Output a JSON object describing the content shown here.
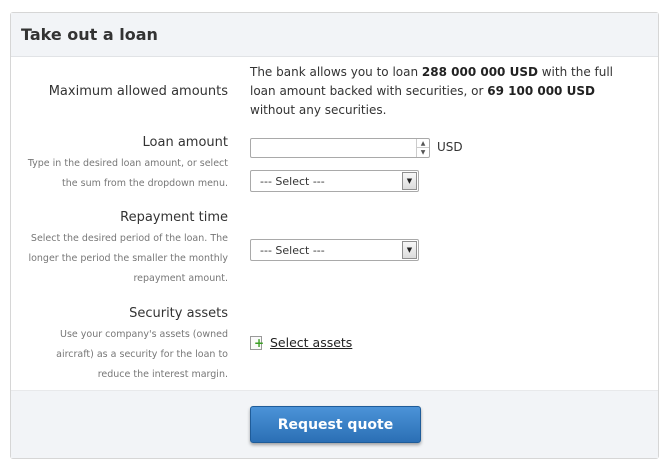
{
  "panel": {
    "title": "Take out a loan"
  },
  "max_amounts": {
    "label": "Maximum allowed amounts",
    "text_1": "The bank allows you to loan ",
    "amount_full": "288 000 000 USD",
    "text_2": " with the full loan amount backed with securities, or ",
    "amount_partial": "69 100 000 USD",
    "text_3": " without any securities."
  },
  "loan_amount": {
    "label": "Loan amount",
    "help_lines": [
      "Type in the desired loan amount, or select",
      "the sum from the dropdown menu."
    ],
    "input_value": "",
    "unit": "USD",
    "select_value": "--- Select ---"
  },
  "repayment": {
    "label": "Repayment time",
    "help_lines": [
      "Select the desired period of the loan. The",
      "longer the period the smaller the monthly",
      "repayment amount."
    ],
    "select_value": "--- Select ---"
  },
  "security": {
    "label": "Security assets",
    "help_lines": [
      "Use your company's assets (owned",
      "aircraft) as a security for the loan to",
      "reduce the interest margin."
    ],
    "link_label": "Select assets",
    "icon": "add-document-icon"
  },
  "footer": {
    "request_label": "Request quote"
  },
  "colors": {
    "button": "#3a80c8",
    "panel_bg": "#f2f4f7"
  }
}
